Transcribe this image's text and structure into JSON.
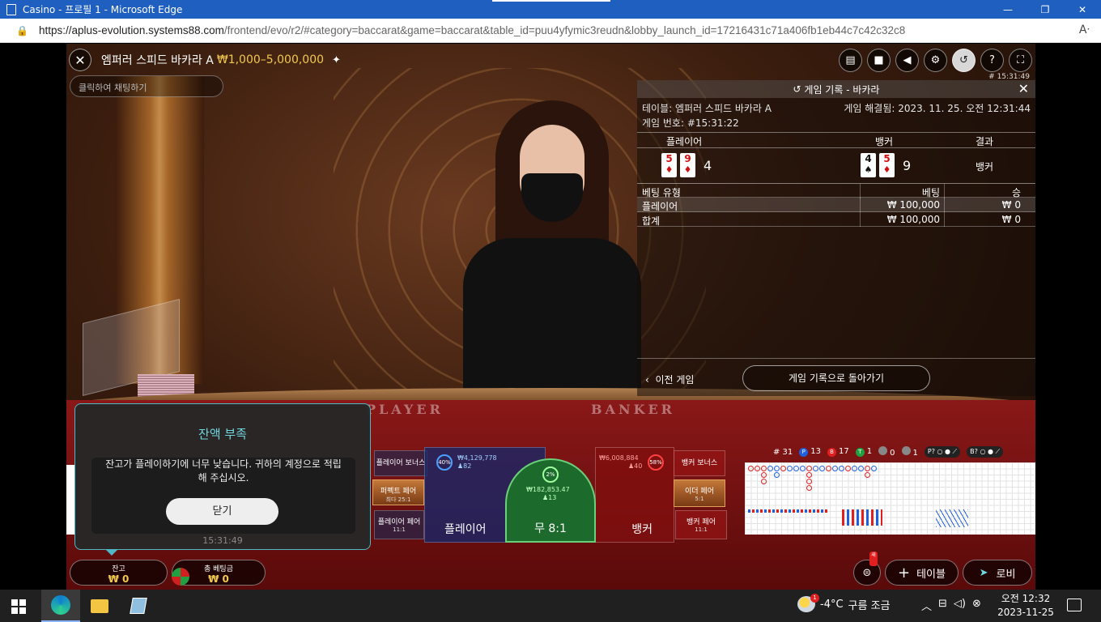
{
  "window": {
    "title": "Casino - 프로필 1 - Microsoft Edge",
    "url_host": "https://aplus-evolution.systems88.com",
    "url_path": "/frontend/evo/r2/#category=baccarat&game=baccarat&table_id=puu4yfymic3reudn&lobby_launch_id=17216431c71a406fb1eb44c7c42c32c8"
  },
  "game": {
    "table_name": "엠퍼러 스피드 바카라 A",
    "limit": "₩1,000–5,000,000",
    "chat_placeholder": "클릭하여 채팅하기",
    "timestamp": "# 15:31:49",
    "felt_player": "PLAYER",
    "felt_banker": "BANKER"
  },
  "history": {
    "title": "게임 기록 - 바카라",
    "table_line": "테이블: 엠퍼러 스피드 바카라 A",
    "round_line": "게임 번호: #15:31:22",
    "settled_line": "게임 해결됨: 2023. 11. 25. 오전 12:31:44",
    "col_player": "플레이어",
    "col_banker": "뱅커",
    "col_result": "결과",
    "player_cards": [
      {
        "rank": "5",
        "suit": "♦"
      },
      {
        "rank": "9",
        "suit": "♦"
      }
    ],
    "player_score": "4",
    "banker_cards": [
      {
        "rank": "4",
        "suit": "♠"
      },
      {
        "rank": "5",
        "suit": "♦"
      }
    ],
    "banker_score": "9",
    "result": "뱅커",
    "bet_headers": {
      "type": "베팅 유형",
      "bet": "베팅",
      "win": "승"
    },
    "bet_rows": [
      {
        "type": "플레이어",
        "bet": "₩ 100,000",
        "win": "₩ 0"
      },
      {
        "type": "합계",
        "bet": "₩ 100,000",
        "win": "₩ 0"
      }
    ],
    "prev_game": "이전 게임",
    "back_button": "게임 기록으로 돌아가기"
  },
  "bets": {
    "player_bonus": "플레이어 보너스",
    "perfect_pair": "퍼펙트 페어",
    "perfect_pair_odds": "최다 25:1",
    "player_pair": "플레이어 페어",
    "player_pair_odds": "11:1",
    "player_label": "플레이어",
    "player_pct": "40%",
    "player_amount": "₩4,129,778",
    "player_count": "82",
    "tie_label": "무 8:1",
    "tie_pct": "2%",
    "tie_amount": "₩182,853.47",
    "tie_count": "13",
    "banker_label": "뱅커",
    "banker_pct": "58%",
    "banker_amount": "₩6,008,884",
    "banker_count": "40",
    "banker_bonus": "뱅커 보너스",
    "either_pair": "이더 페어",
    "either_pair_odds": "5:1",
    "banker_pair": "뱅커 페어",
    "banker_pair_odds": "11:1"
  },
  "road_stats": {
    "total": "# 31",
    "player": "13",
    "banker": "17",
    "tie": "1",
    "player_pair": "0",
    "banker_pair": "1",
    "p_predict": "P?",
    "b_predict": "B?"
  },
  "popup": {
    "title": "잔액 부족",
    "message": "잔고가 플레이하기에 너무 낮습니다. 귀하의 계정으로 적립해 주십시오.",
    "button": "닫기",
    "time": "15:31:49"
  },
  "footer": {
    "balance_label": "잔고",
    "balance_value": "₩ 0",
    "total_bet_label": "총 베팅금",
    "total_bet_value": "₩ 0",
    "badge": "새",
    "table_button": "테이블",
    "lobby_button": "로비"
  },
  "taskbar": {
    "weather_temp": "-4°C",
    "weather_desc": "구름 조금",
    "weather_badge": "1",
    "time": "오전 12:32",
    "date": "2023-11-25"
  },
  "colors": {
    "accent_gold": "#f2c94c",
    "popup_border": "#4fb8c4",
    "banker_red": "#e02020",
    "player_blue": "#2060e0",
    "tie_green": "#1c6b2c"
  }
}
